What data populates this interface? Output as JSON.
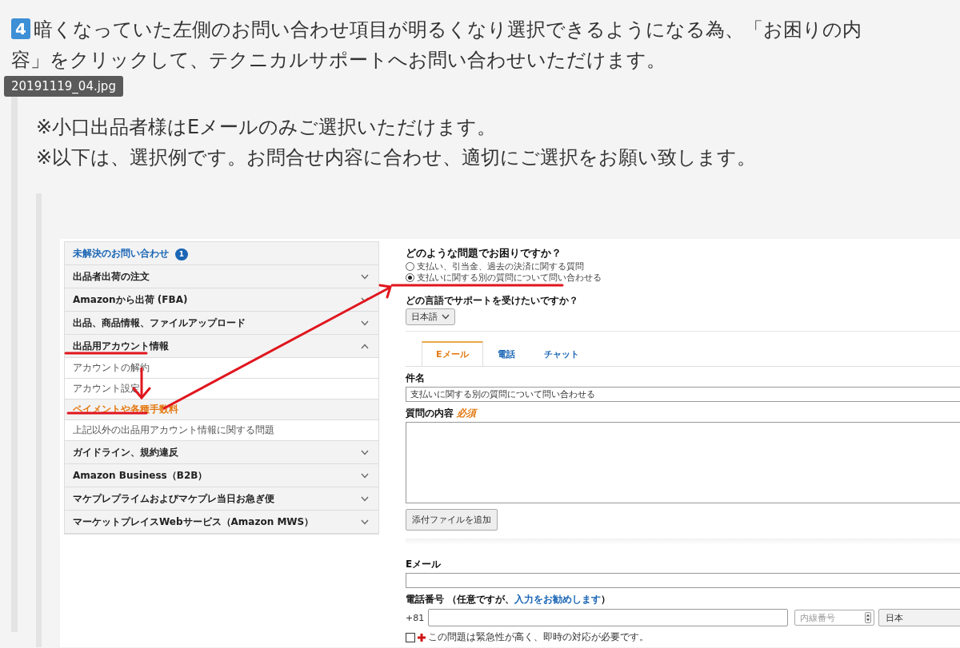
{
  "article": {
    "step_badge": "4",
    "paragraph": "暗くなっていた左側のお問い合わせ項目が明るくなり選択できるようになる為、「お困りの内容」をクリックして、テクニカルサポートへお問い合わせいただけます。",
    "image_tooltip": "20191119_04.jpg",
    "notes": [
      "※小口出品者様はEメールのみご選択いただけます。",
      "※以下は、選択例です。お問合せ内容に合わせ、適切にご選択をお願い致します。"
    ]
  },
  "screenshot": {
    "sidebar": [
      {
        "kind": "header",
        "label": "未解決のお問い合わせ",
        "badge": "1"
      },
      {
        "kind": "category",
        "label": "出品者出荷の注文",
        "expanded": false
      },
      {
        "kind": "category",
        "label": "Amazonから出荷 (FBA)",
        "expanded": false
      },
      {
        "kind": "category",
        "label": "出品、商品情報、ファイルアップロード",
        "expanded": false
      },
      {
        "kind": "category",
        "label": "出品用アカウント情報",
        "expanded": true,
        "children": [
          {
            "label": "アカウントの解約",
            "selected": false
          },
          {
            "label": "アカウント設定",
            "selected": false
          },
          {
            "label": "ペイメントや各種手数料",
            "selected": true
          },
          {
            "label": "上記以外の出品用アカウント情報に関する問題",
            "selected": false
          }
        ]
      },
      {
        "kind": "category",
        "label": "ガイドライン、規約違反",
        "expanded": false
      },
      {
        "kind": "category",
        "label": "Amazon Business（B2B）",
        "expanded": false
      },
      {
        "kind": "category",
        "label": "マケプレプライムおよびマケプレ当日お急ぎ便",
        "expanded": false
      },
      {
        "kind": "category",
        "label": "マーケットプレイスWebサービス（Amazon MWS）",
        "expanded": false
      }
    ],
    "form": {
      "question": "どのような問題でお困りですか？",
      "options": [
        {
          "label": "支払い、引当金、過去の決済に関する質問",
          "selected": false
        },
        {
          "label": "支払いに関する別の質問について問い合わせる",
          "selected": true
        }
      ],
      "language_label": "どの言語でサポートを受けたいですか？",
      "language": "日本語",
      "tabs": [
        {
          "label": "Eメール",
          "selected": true
        },
        {
          "label": "電話",
          "selected": false
        },
        {
          "label": "チャット",
          "selected": false
        }
      ],
      "subject_label": "件名",
      "subject": "支払いに関する別の質問について問い合わせる",
      "body_label": "質問の内容",
      "required": "必須",
      "attach_button": "添付ファイルを追加",
      "email_label": "Eメール",
      "phone_label": "電話番号 （任意ですが、",
      "phone_link": "入力をお勧めします",
      "phone_label_end": "）",
      "country_code": "+81",
      "extension_placeholder": "内線番号",
      "country": "日本",
      "urgent": {
        "label": "この問題は緊急性が高く、即時の対応が必要です。",
        "checked": false
      }
    }
  }
}
